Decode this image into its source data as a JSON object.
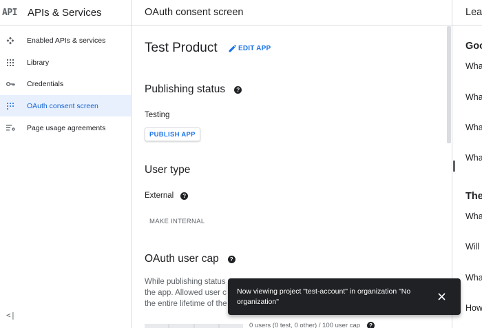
{
  "sidebar": {
    "logo": "API",
    "title": "APIs & Services",
    "items": [
      {
        "label": "Enabled APIs & services",
        "icon": "api-diamond-icon"
      },
      {
        "label": "Library",
        "icon": "library-grid-icon"
      },
      {
        "label": "Credentials",
        "icon": "key-icon"
      },
      {
        "label": "OAuth consent screen",
        "icon": "consent-dots-icon",
        "active": true
      },
      {
        "label": "Page usage agreements",
        "icon": "settings-list-icon"
      }
    ],
    "collapse_icon": "collapse-left-icon"
  },
  "main": {
    "header": "OAuth consent screen",
    "app_name": "Test Product",
    "edit_app": "EDIT APP",
    "publishing": {
      "heading": "Publishing status",
      "status": "Testing",
      "button": "PUBLISH APP"
    },
    "user_type": {
      "heading": "User type",
      "value": "External",
      "button": "MAKE INTERNAL"
    },
    "user_cap": {
      "heading": "OAuth user cap",
      "description_lines": [
        "While publishing status",
        "the app. Allowed user c",
        "the entire lifetime of the"
      ],
      "users_text": "0 users (0 test, 0 other) / 100 user cap"
    }
  },
  "learn": {
    "header": "Lea",
    "sections": [
      {
        "heading": "Goo",
        "questions": [
          "Wha",
          "Wha",
          "Wha",
          "Wha"
        ]
      },
      {
        "heading": "The",
        "questions": [
          "Wha",
          "Will",
          "Wha",
          "How"
        ]
      }
    ]
  },
  "snackbar": {
    "message": "Now viewing project \"test-account\" in organization \"No organization\"",
    "close_icon": "close-icon"
  },
  "colors": {
    "accent": "#1a73e8",
    "active_bg": "#e8f0fe",
    "active_text": "#1967d2",
    "snackbar_bg": "#202124"
  }
}
